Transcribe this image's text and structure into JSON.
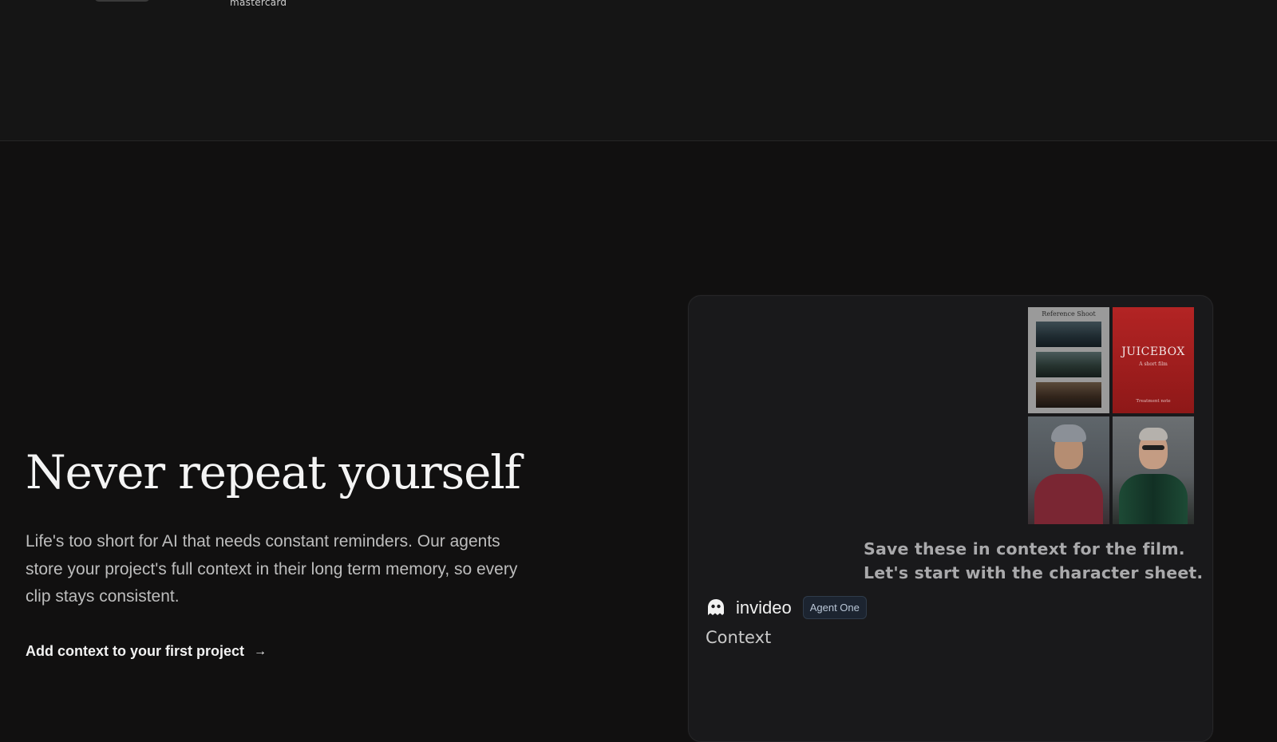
{
  "header": {
    "partner_logo_text": "mastercard"
  },
  "hero": {
    "headline": "Never repeat yourself",
    "body": "Life's too short for AI that needs constant reminders. Our agents store your project's full context in their long term memory, so every clip stays consistent.",
    "cta_label": "Add context to your first project",
    "cta_arrow": "→"
  },
  "card": {
    "thumbnails": {
      "reference_title": "Reference Shoot",
      "poster_title": "JUICEBOX",
      "poster_subtitle": "A short film",
      "poster_footer": "Treatment note"
    },
    "message": "Save these in context for the film. Let's start with the character sheet.",
    "brand_name": "invideo",
    "agent_badge": "Agent One",
    "context_label": "Context"
  },
  "icons": {
    "brand_icon": "ghost-icon",
    "cta_icon": "arrow-right-icon"
  },
  "colors": {
    "background": "#111010",
    "card_background": "#19191b",
    "badge_background": "#1c2430",
    "poster_red": "#b32424"
  }
}
